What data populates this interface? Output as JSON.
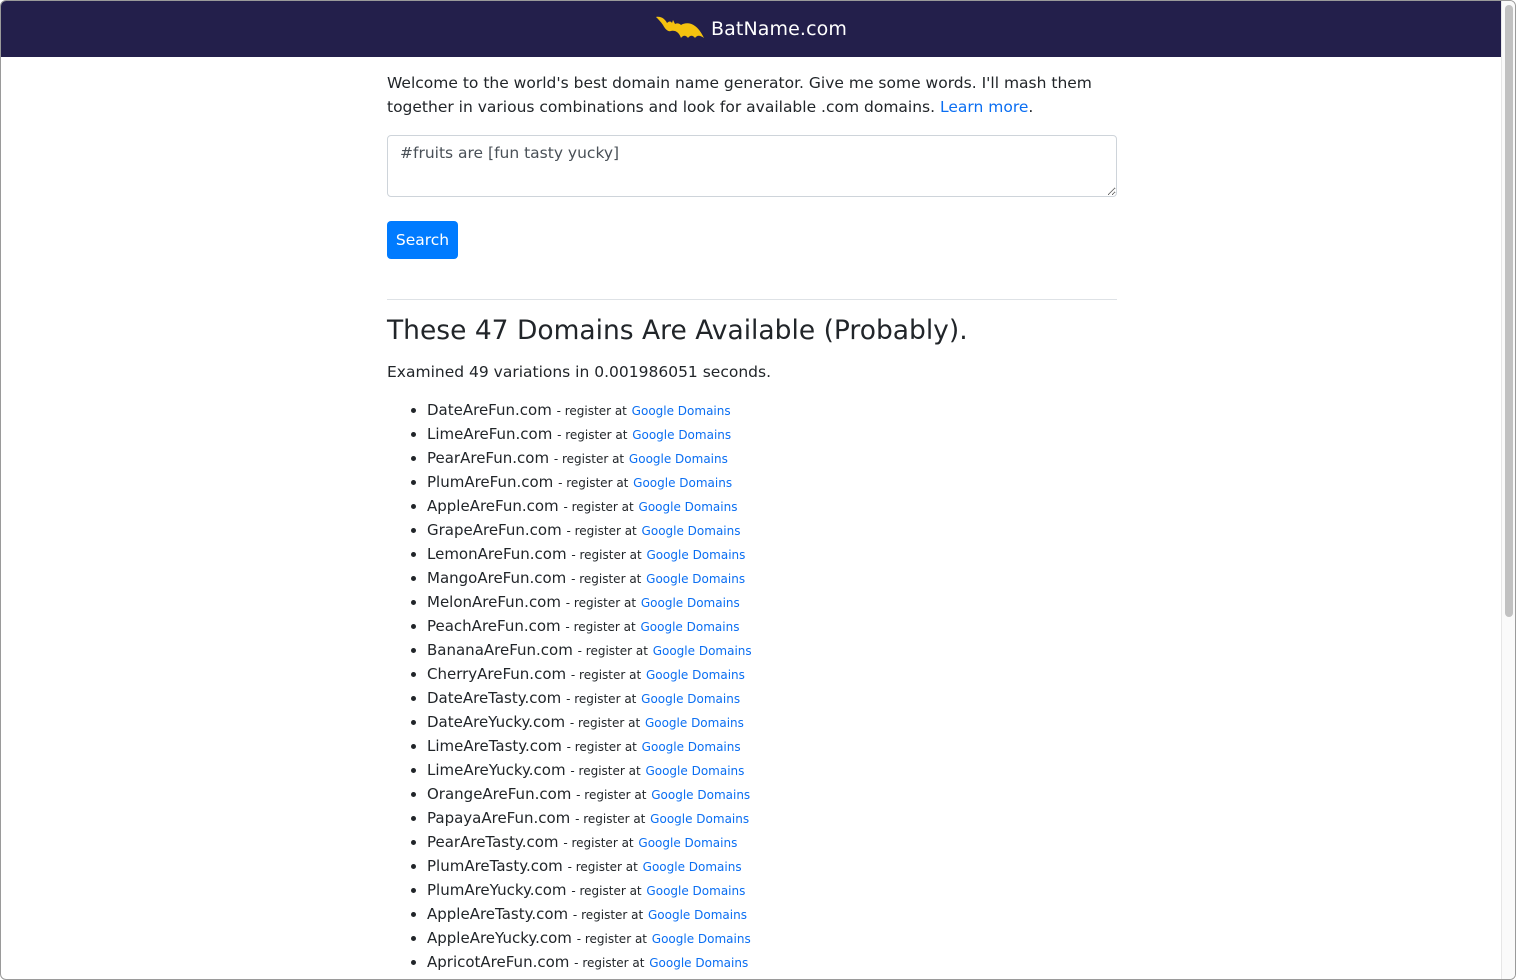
{
  "header": {
    "brand": "BatName.com",
    "logo_icon": "bat-icon",
    "colors": {
      "navbar": "#231f4b",
      "logo": "#f5c20f"
    }
  },
  "intro": {
    "text": "Welcome to the world's best domain name generator. Give me some words. I'll mash them together in various combinations and look for available .com domains.",
    "link_label": "Learn more",
    "trailing": "."
  },
  "query": {
    "value": "#fruits are [fun tasty yucky]"
  },
  "search": {
    "label": "Search",
    "color": "#007bff"
  },
  "results": {
    "heading": "These 47 Domains Are Available (Probably).",
    "stats": "Examined 49 variations in 0.001986051 seconds.",
    "register_prefix": "- register at",
    "register_link": "Google Domains",
    "link_color": "#0a6ef2",
    "domains": [
      "DateAreFun.com",
      "LimeAreFun.com",
      "PearAreFun.com",
      "PlumAreFun.com",
      "AppleAreFun.com",
      "GrapeAreFun.com",
      "LemonAreFun.com",
      "MangoAreFun.com",
      "MelonAreFun.com",
      "PeachAreFun.com",
      "BananaAreFun.com",
      "CherryAreFun.com",
      "DateAreTasty.com",
      "DateAreYucky.com",
      "LimeAreTasty.com",
      "LimeAreYucky.com",
      "OrangeAreFun.com",
      "PapayaAreFun.com",
      "PearAreTasty.com",
      "PlumAreTasty.com",
      "PlumAreYucky.com",
      "AppleAreTasty.com",
      "AppleAreYucky.com",
      "ApricotAreFun.com"
    ]
  }
}
